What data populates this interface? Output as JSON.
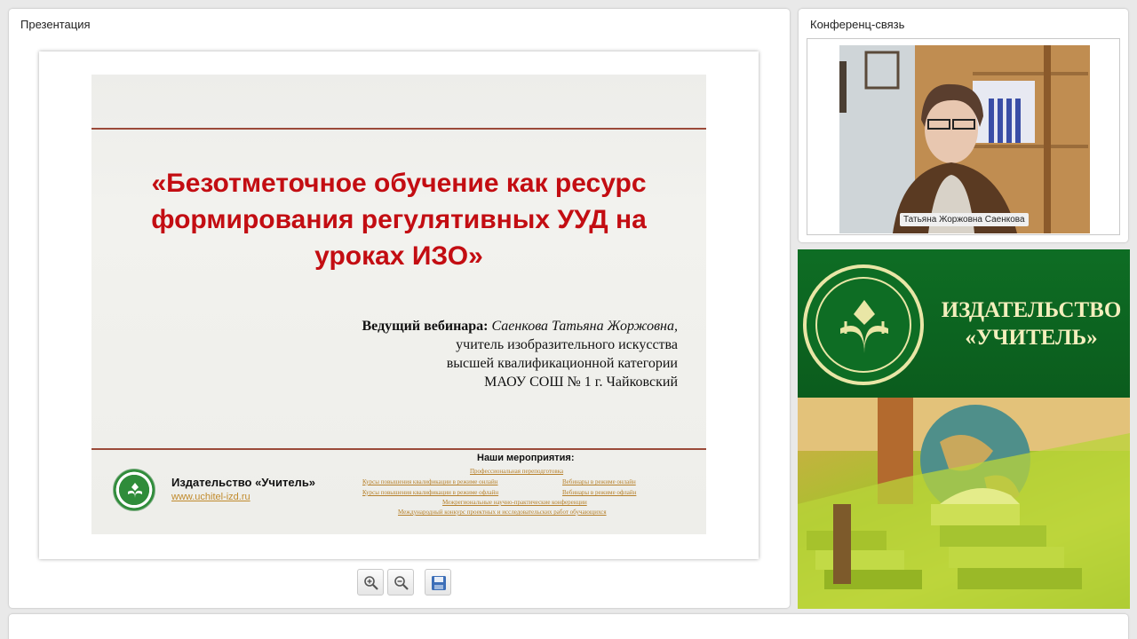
{
  "presentation": {
    "panel_title": "Презентация",
    "slide": {
      "title": "«Безотметочное обучение как ресурс формирования регулятивных УУД на уроках ИЗО»",
      "presenter_label": "Ведущий вебинара:",
      "presenter_name": "Саенкова Татьяна Жоржовна,",
      "presenter_lines": [
        "учитель изобразительного искусства",
        "высшей квалификационной категории",
        "МАОУ СОШ № 1 г. Чайковский"
      ],
      "publisher_name": "Издательство «Учитель»",
      "publisher_url": "www.uchitel-izd.ru",
      "events_heading": "Наши мероприятия:",
      "events": [
        "Профессиональная переподготовка",
        "Курсы повышения квалификации в режиме онлайн",
        "Вебинары в режиме онлайн",
        "Курсы повышения квалификации в режиме офлайн",
        "Вебинары в режиме офлайн",
        "Межрегиональные научно-практические конференции",
        "Международный конкурс проектных и исследовательских работ обучающихся"
      ]
    },
    "toolbar": {
      "zoom_in_icon": "zoom-in-icon",
      "zoom_out_icon": "zoom-out-icon",
      "save_icon": "save-icon"
    }
  },
  "conference": {
    "panel_title": "Конференц-связь",
    "speaker_name": "Татьяна Жоржовна Саенкова"
  },
  "advertisement": {
    "line1": "ИЗДАТЕЛЬСТВО",
    "line2": "«УЧИТЕЛЬ»"
  },
  "colors": {
    "slide_title": "#c30d12",
    "brand_green": "#0e6d24",
    "brand_cream": "#f4efbd",
    "link_gold": "#b6802b"
  }
}
